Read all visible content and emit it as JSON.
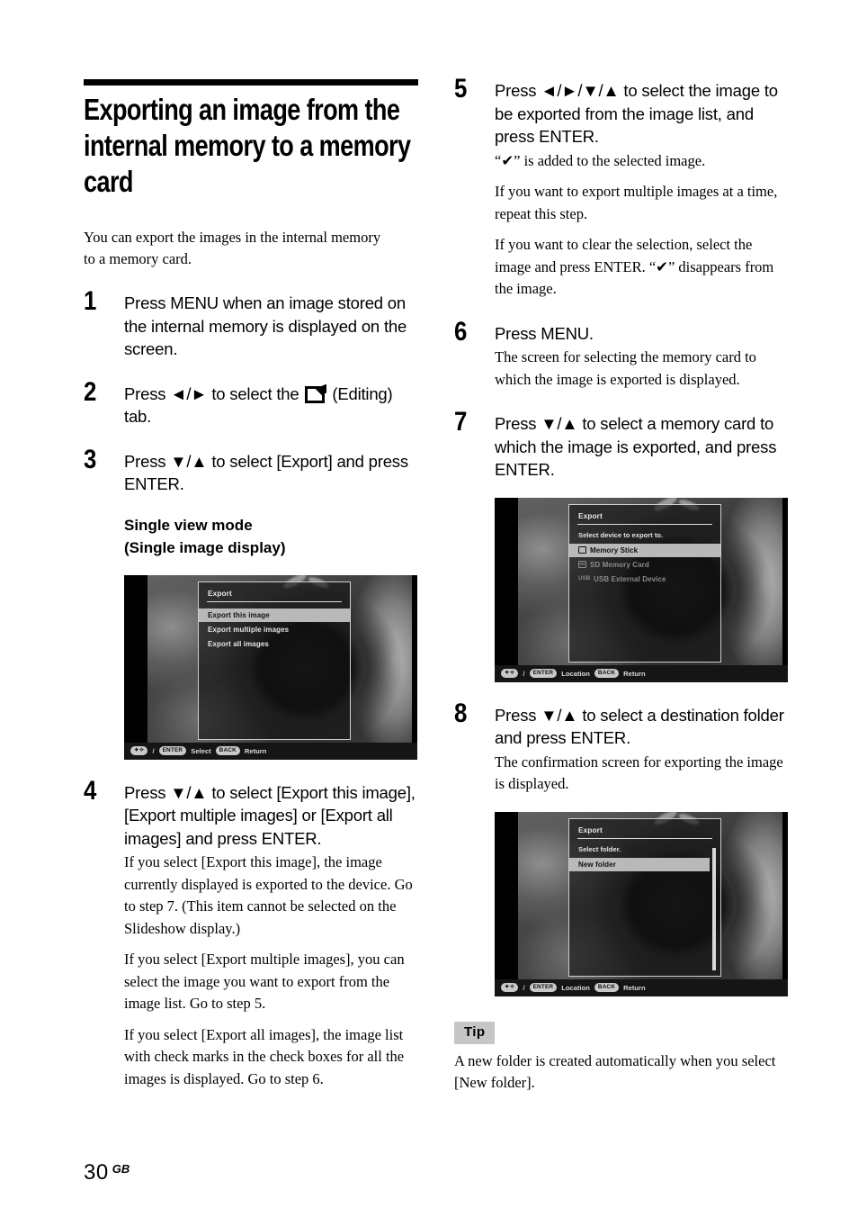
{
  "document": {
    "chapter_title": "Exporting an image from the internal memory to a memory card",
    "intro": "You can export the images in the internal memory to a memory card.",
    "page_number": "30",
    "page_locale": "GB"
  },
  "steps": [
    {
      "number": "1",
      "heading": "Press MENU when an image stored on the internal memory is displayed on the screen."
    },
    {
      "number": "2",
      "heading_before_icon": "Press ◄/► to select the ",
      "icon_name": "editing-tab-icon",
      "heading_after_icon": " (Editing) tab."
    },
    {
      "number": "3",
      "heading": "Press ▼/▲ to select [Export] and press ENTER.",
      "subheading": "Single view mode\n(Single image display)"
    },
    {
      "number": "4",
      "heading": "Press ▼/▲ to select [Export this image], [Export multiple images] or [Export all images] and press ENTER.",
      "paragraphs": [
        "If you select [Export this image], the image currently displayed is exported to the device. Go to step 7. (This item cannot be selected on the Slideshow display.)",
        "If you select [Export multiple images], you can select the image you want to export from the image list. Go to step 5.",
        "If you select [Export all images], the image list with check marks in the check boxes for all the images is displayed. Go to step 6."
      ]
    },
    {
      "number": "5",
      "heading": "Press ◄/►/▼/▲ to select the image to be exported from the image list, and press ENTER.",
      "paragraphs": [
        "“✔” is added to the selected image.",
        "If you want to export multiple images at a time, repeat this step.",
        "If you want to clear the selection, select the image and press ENTER. “✔” disappears from the image."
      ]
    },
    {
      "number": "6",
      "heading": "Press MENU.",
      "paragraphs": [
        "The screen for selecting the memory card to which the image is exported is displayed."
      ]
    },
    {
      "number": "7",
      "heading": "Press ▼/▲ to select a memory card to which the image is exported, and press ENTER."
    },
    {
      "number": "8",
      "heading": "Press ▼/▲ to select a destination folder and press ENTER.",
      "paragraphs": [
        "The confirmation screen for exporting the image is displayed."
      ]
    }
  ],
  "screenshots": {
    "export_menu": {
      "title": "Export",
      "items": [
        {
          "label": "Export this image",
          "selected": true
        },
        {
          "label": "Export multiple images",
          "selected": false
        },
        {
          "label": "Export all images",
          "selected": false
        }
      ],
      "status": {
        "arrows": "✦✧",
        "slash": "/",
        "enter_key": "ENTER",
        "enter_action": "Select",
        "back_key": "BACK",
        "back_action": "Return"
      }
    },
    "select_device": {
      "title": "Export",
      "caption": "Select device to export to.",
      "items": [
        {
          "label": "Memory Stick",
          "icon": "memory-stick-icon",
          "icon_text": "",
          "selected": true,
          "dimmed": false
        },
        {
          "label": "SD Memory Card",
          "icon": "sd-card-icon",
          "icon_text": "SD",
          "selected": false,
          "dimmed": true
        },
        {
          "label": "USB External Device",
          "icon": "usb-icon",
          "icon_text": "USB",
          "selected": false,
          "dimmed": true
        }
      ],
      "status": {
        "arrows": "✦✧",
        "slash": "/",
        "enter_key": "ENTER",
        "enter_action": "Location",
        "back_key": "BACK",
        "back_action": "Return"
      }
    },
    "select_folder": {
      "title": "Export",
      "caption": "Select folder.",
      "items": [
        {
          "label": "New folder",
          "selected": true
        }
      ],
      "status": {
        "arrows": "✦✧",
        "slash": "/",
        "enter_key": "ENTER",
        "enter_action": "Location",
        "back_key": "BACK",
        "back_action": "Return"
      }
    }
  },
  "tip": {
    "label": "Tip",
    "body": "A new folder is created automatically when you select [New folder]."
  },
  "colors": {
    "highlight_bar": "#b9b9b9",
    "tip_background": "#c6c6c6",
    "rule": "#000000"
  }
}
